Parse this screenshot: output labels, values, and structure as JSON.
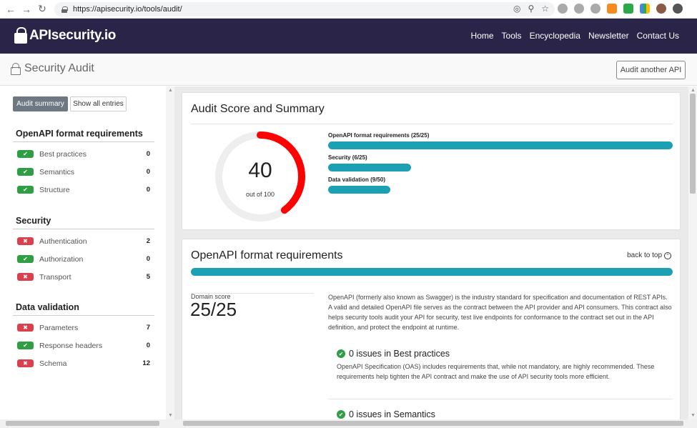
{
  "browser": {
    "url": "https://apisecurity.io/tools/audit/"
  },
  "site": {
    "logo_text": "APIsecurity.io",
    "nav": [
      "Home",
      "Tools",
      "Encyclopedia",
      "Newsletter",
      "Contact Us"
    ]
  },
  "title_bar": {
    "title": "Security Audit",
    "audit_another": "Audit another API"
  },
  "sidebar": {
    "buttons": {
      "summary": "Audit summary",
      "all_entries": "Show all entries"
    },
    "sections": [
      {
        "heading": "OpenAPI format requirements",
        "items": [
          {
            "label": "Best practices",
            "count": "0",
            "status": "ok"
          },
          {
            "label": "Semantics",
            "count": "0",
            "status": "ok"
          },
          {
            "label": "Structure",
            "count": "0",
            "status": "ok"
          }
        ]
      },
      {
        "heading": "Security",
        "items": [
          {
            "label": "Authentication",
            "count": "2",
            "status": "bad"
          },
          {
            "label": "Authorization",
            "count": "0",
            "status": "ok"
          },
          {
            "label": "Transport",
            "count": "5",
            "status": "bad"
          }
        ]
      },
      {
        "heading": "Data validation",
        "items": [
          {
            "label": "Parameters",
            "count": "7",
            "status": "bad"
          },
          {
            "label": "Response headers",
            "count": "0",
            "status": "ok"
          },
          {
            "label": "Schema",
            "count": "12",
            "status": "bad"
          }
        ]
      }
    ]
  },
  "summary_card": {
    "title": "Audit Score and Summary",
    "score": "40",
    "score_sub": "out of 100",
    "score_fraction": 0.4,
    "colors": {
      "gauge_fill": "#ff0000",
      "gauge_track": "#eeeeee",
      "bar": "#1ba1b3"
    },
    "bars": [
      {
        "label": "OpenAPI format requirements (25/25)",
        "fraction": 1.0
      },
      {
        "label": "Security (6/25)",
        "fraction": 0.24
      },
      {
        "label": "Data validation (9/50)",
        "fraction": 0.18
      }
    ]
  },
  "openapi_card": {
    "title": "OpenAPI format requirements",
    "back_to_top": "back to top",
    "domain_score_label": "Domain score",
    "domain_score_value": "25/25",
    "description": "OpenAPI (formerly also known as Swagger) is the industry standard for specification and documentation of REST APIs. A valid and detailed OpenAPI file serves as the contract between the API provider and API consumers. This contract also helps security tools audit your API for security, test live endpoints for conformance to the contract set out in the API definition, and protect the endpoint at runtime.",
    "issues": [
      {
        "title": "0 issues in Best practices",
        "description": "OpenAPI Specification (OAS) includes requirements that, while not mandatory, are highly recommended. These requirements help tighten the API contract and make the use of API security tools more efficient."
      },
      {
        "title": "0 issues in Semantics",
        "description": ""
      }
    ]
  }
}
